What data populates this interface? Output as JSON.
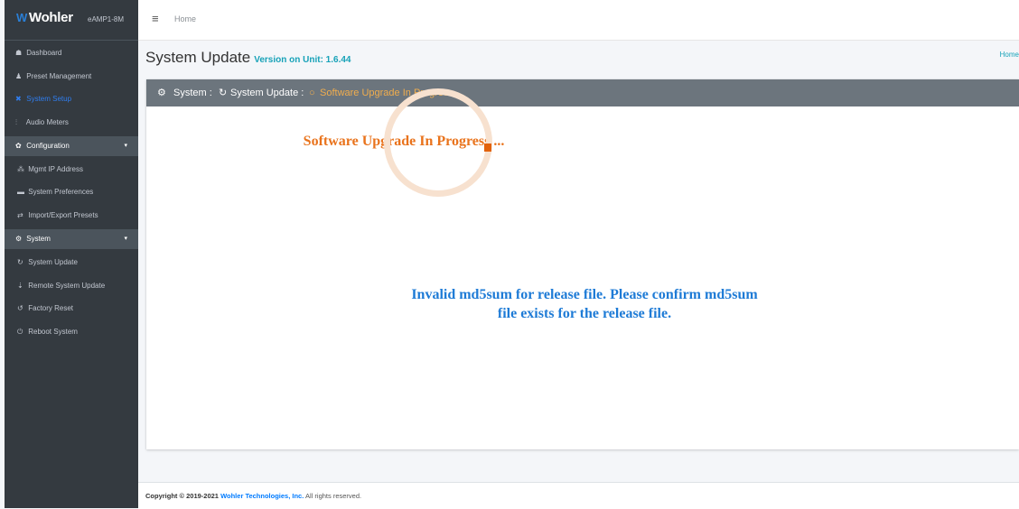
{
  "brand": {
    "logo": "Wohler",
    "unit": "eAMP1-8M"
  },
  "sidebar": {
    "items": [
      {
        "icon": "☗",
        "label": "Dashboard"
      },
      {
        "icon": "♟",
        "label": "Preset Management"
      },
      {
        "icon": "✖",
        "label": "System Setup"
      },
      {
        "icon": "⫶",
        "label": "Audio Meters"
      },
      {
        "icon": "✿",
        "label": "Configuration"
      },
      {
        "icon": "⁂",
        "label": "Mgmt IP Address"
      },
      {
        "icon": "▬",
        "label": "System Preferences"
      },
      {
        "icon": "⇄",
        "label": "Import/Export Presets"
      },
      {
        "icon": "⚙",
        "label": "System"
      },
      {
        "icon": "↻",
        "label": "System Update"
      },
      {
        "icon": "⇣",
        "label": "Remote System Update"
      },
      {
        "icon": "↺",
        "label": "Factory Reset"
      },
      {
        "icon": "⏻",
        "label": "Reboot System"
      }
    ],
    "caret": "▾"
  },
  "topbar": {
    "menu_icon": "≡",
    "breadcrumb_home": "Home"
  },
  "header": {
    "title": "System Update",
    "version": "Version on Unit: 1.6.44",
    "breadcrumb_right": "Home"
  },
  "card": {
    "crumb_icon": "⚙",
    "crumb_system": "System :",
    "crumb_update_icon": "↻",
    "crumb_update": "System Update :",
    "crumb_progress_icon": "○",
    "crumb_progress": "Software Upgrade In Progress",
    "upgrade_title": "Software Upgrade In Progress ...",
    "message_line1": "Invalid md5sum for release file. Please confirm md5sum",
    "message_line2": "file exists for the release file."
  },
  "footer": {
    "copyright": "Copyright © 2019-2021",
    "company": "Wohler Technologies, Inc.",
    "rights": "All rights reserved."
  },
  "colors": {
    "sidebar_bg": "#343a40",
    "active_link": "#2f7ef0",
    "card_header_bg": "#6c757d",
    "progress_text": "#f0ad4e",
    "upgrade_title": "#e9731c",
    "message": "#1e7bd6",
    "version": "#17a2b8"
  }
}
